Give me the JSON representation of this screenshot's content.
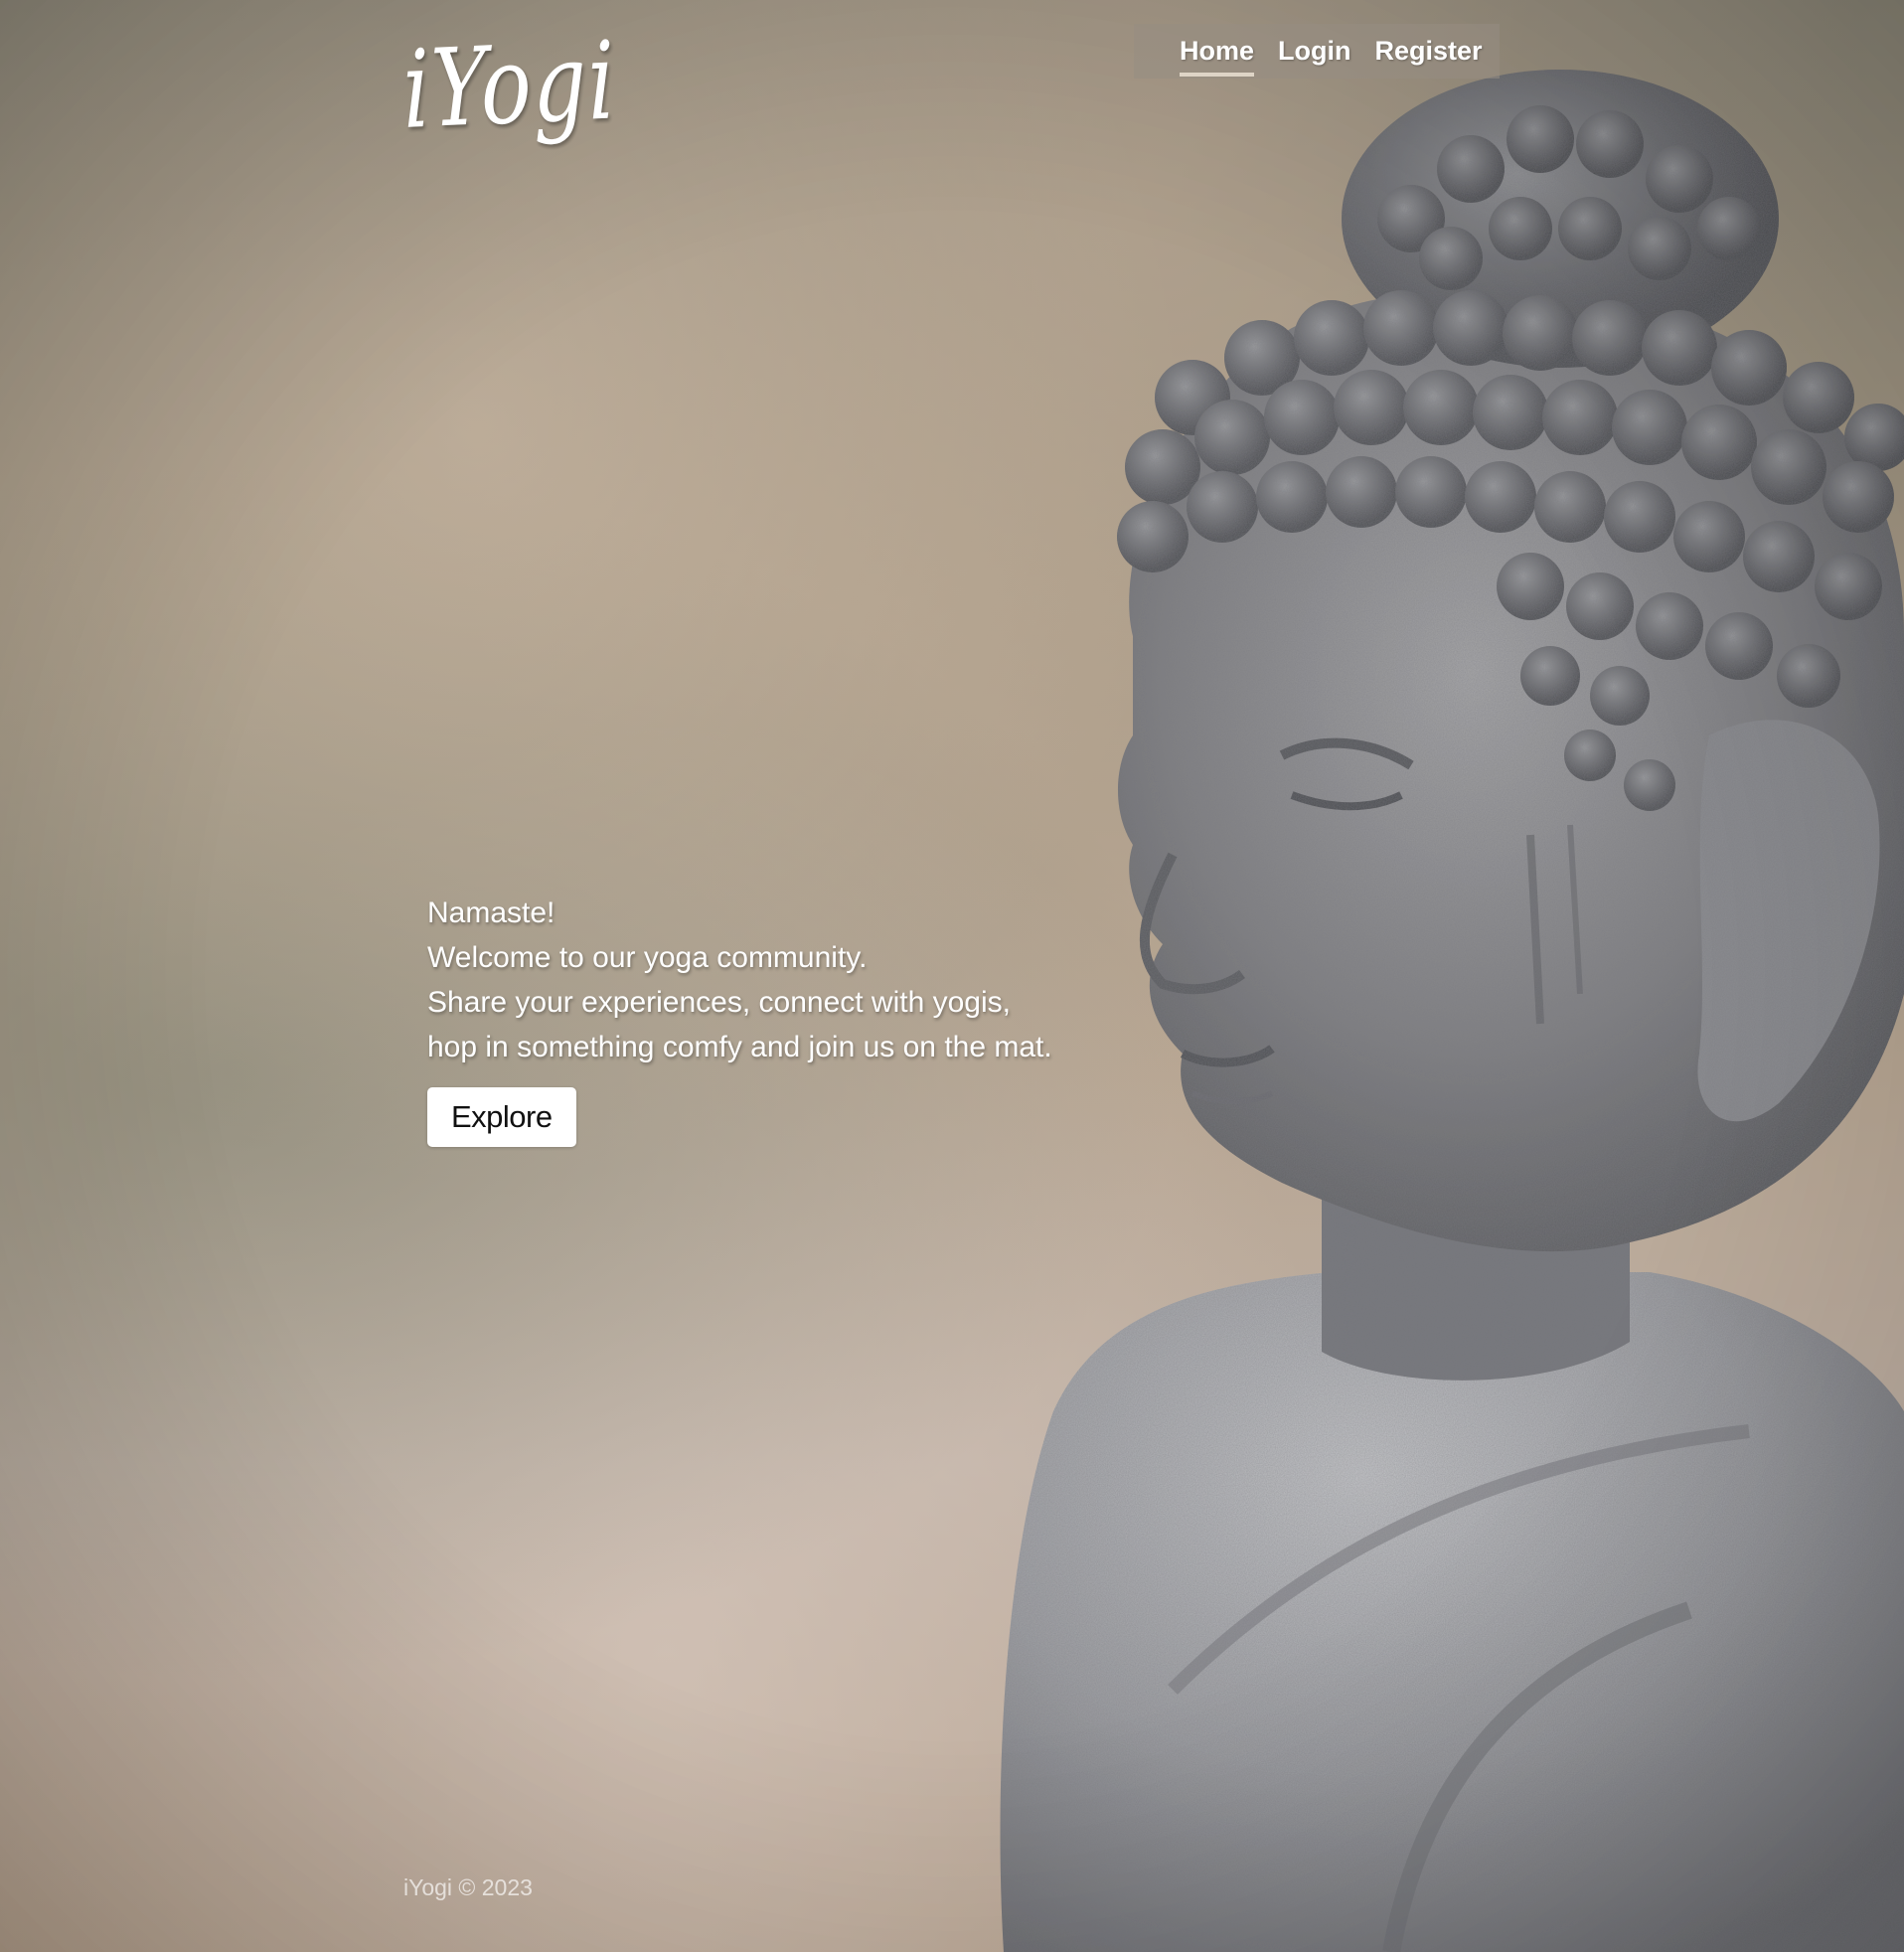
{
  "brand": {
    "logo_text": "iYogi"
  },
  "nav": {
    "items": [
      {
        "label": "Home",
        "active": true
      },
      {
        "label": "Login",
        "active": false
      },
      {
        "label": "Register",
        "active": false
      }
    ]
  },
  "hero": {
    "lines": [
      "Namaste!",
      "Welcome to our yoga community.",
      "Share your experiences, connect with yogis,",
      "hop in something comfy and join us on the mat."
    ],
    "button_label": "Explore"
  },
  "footer": {
    "text": "iYogi © 2023"
  },
  "colors": {
    "nav_background": "#968c82",
    "button_background": "#ffffff",
    "button_text": "#111111",
    "text": "#ffffff"
  }
}
